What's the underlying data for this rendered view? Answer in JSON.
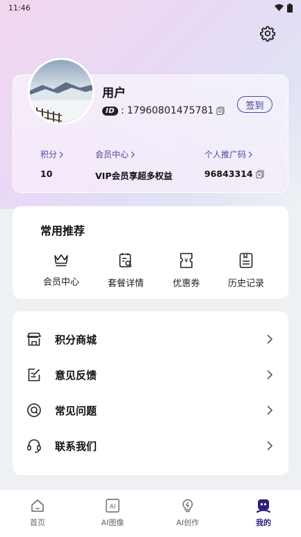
{
  "status_bar": {
    "time": "11:46"
  },
  "profile": {
    "username": "用户",
    "id_badge": "ID",
    "id_separator": ":",
    "user_id": "17960801475781",
    "checkin_label": "签到"
  },
  "stats": [
    {
      "label": "积分",
      "value": "10"
    },
    {
      "label": "会员中心",
      "value": "VIP会员享超多权益"
    },
    {
      "label": "个人推广码",
      "value": "96843314"
    }
  ],
  "recommend": {
    "title": "常用推荐",
    "items": [
      {
        "label": "会员中心",
        "icon": "crown-icon"
      },
      {
        "label": "套餐详情",
        "icon": "package-detail-icon"
      },
      {
        "label": "优惠券",
        "icon": "coupon-icon"
      },
      {
        "label": "历史记录",
        "icon": "history-icon"
      }
    ]
  },
  "menu": [
    {
      "label": "积分商城",
      "icon": "store-icon"
    },
    {
      "label": "意见反馈",
      "icon": "feedback-icon"
    },
    {
      "label": "常见问题",
      "icon": "faq-icon"
    },
    {
      "label": "联系我们",
      "icon": "headset-icon"
    }
  ],
  "tabs": [
    {
      "label": "首页",
      "icon": "home-icon"
    },
    {
      "label": "AI图像",
      "icon": "ai-image-icon"
    },
    {
      "label": "AI创作",
      "icon": "ai-create-icon"
    },
    {
      "label": "我的",
      "icon": "profile-icon",
      "active": true
    }
  ],
  "colors": {
    "accent": "#2a1f7a",
    "link": "#4a4aa0"
  }
}
